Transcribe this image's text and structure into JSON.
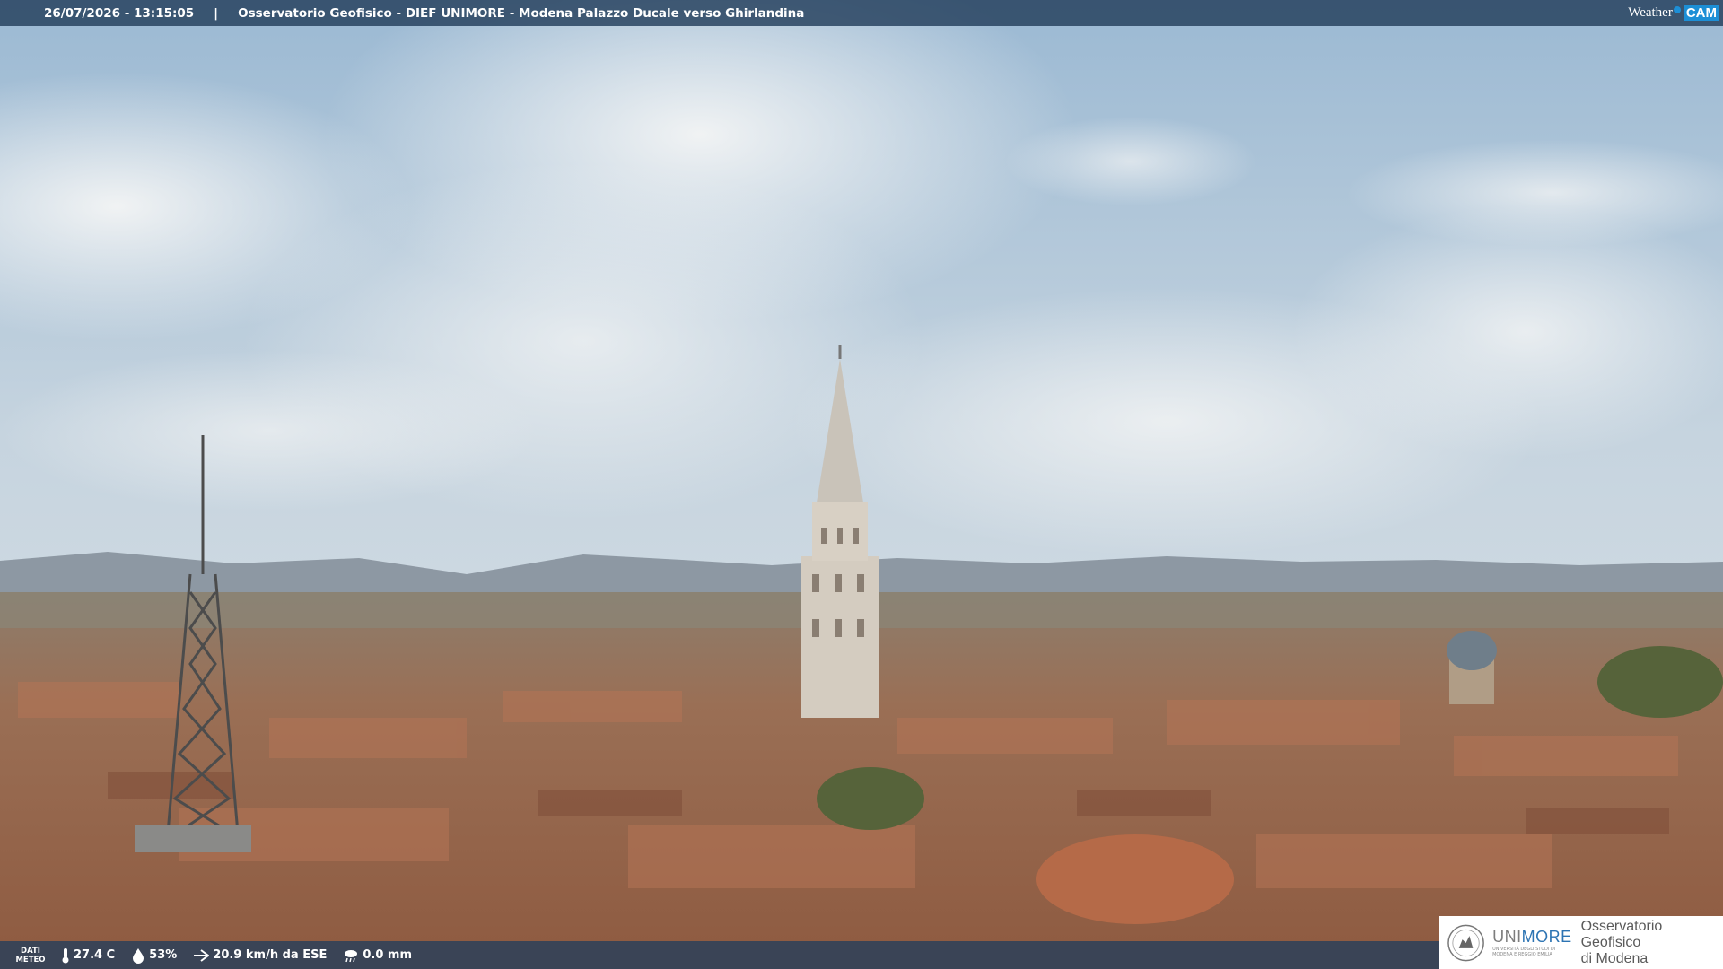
{
  "header": {
    "timestamp": "26/07/2026 - 13:15:05",
    "separator": "|",
    "title": "Osservatorio Geofisico - DIEF UNIMORE - Modena Palazzo Ducale verso Ghirlandina"
  },
  "brand": {
    "weather": "Weather",
    "cam": "CAM"
  },
  "weather": {
    "label_line1": "DATI",
    "label_line2": "METEO",
    "temperature": "27.4 C",
    "humidity": "53%",
    "wind": "20.9 km/h da ESE",
    "rain": "0.0 mm"
  },
  "logo": {
    "uni_prefix": "UNI",
    "uni_suffix": "MORE",
    "uni_sub1": "UNIVERSITÀ DEGLI STUDI DI",
    "uni_sub2": "MODENA E REGGIO EMILIA",
    "obs_line1": "Osservatorio Geofisico",
    "obs_line2": "di Modena"
  },
  "colors": {
    "sky_top": "#a9c3d8",
    "sky_haze": "#dfe6ea",
    "roof": "#a8694a",
    "tower": "#d8d0c4",
    "bar": "#233e5c",
    "accent": "#1d8fd6"
  }
}
